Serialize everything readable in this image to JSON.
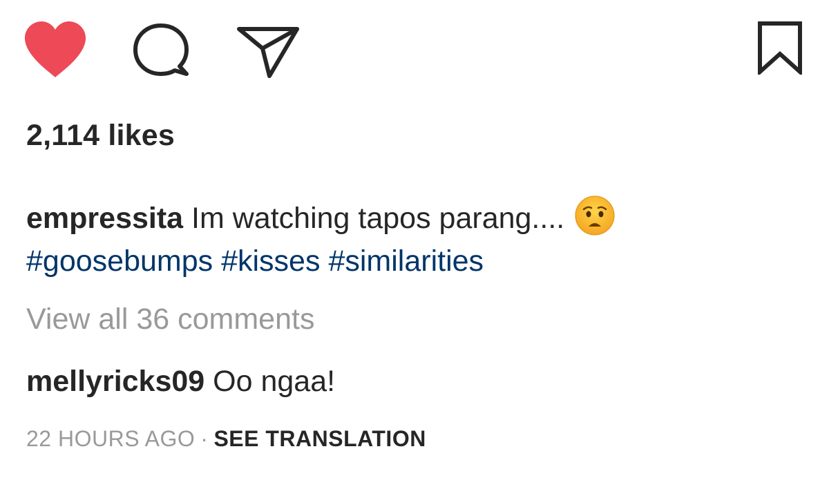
{
  "actions": {
    "like_icon": "heart-filled",
    "comment_icon": "speech-bubble",
    "share_icon": "paper-plane",
    "save_icon": "bookmark",
    "like_color": "#ed4956"
  },
  "likes_text": "2,114 likes",
  "caption": {
    "username": "empressita",
    "text": "Im watching tapos parang....",
    "emoji": "anxious-face",
    "hashtags": [
      "#goosebumps",
      "#kisses",
      "#similarities"
    ]
  },
  "view_comments_text": "View all 36 comments",
  "comment": {
    "username": "mellyricks09",
    "text": "Oo ngaa!"
  },
  "meta": {
    "timestamp": "22 HOURS AGO",
    "separator": "·",
    "see_translation": "SEE TRANSLATION"
  },
  "colors": {
    "text": "#262626",
    "hashtag": "#003569",
    "muted": "#999999"
  }
}
